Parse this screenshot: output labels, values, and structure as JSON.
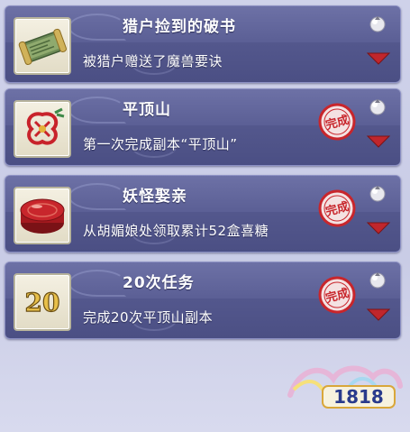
{
  "quests": [
    {
      "title": "猎户捡到的破书",
      "description": "被猎户赠送了魔兽要诀",
      "icon": "scroll-icon",
      "completed": false
    },
    {
      "title": "平顶山",
      "description": "第一次完成副本“平顶山”",
      "icon": "red-knot-icon",
      "completed": true
    },
    {
      "title": "妖怪娶亲",
      "description": "从胡媚娘处领取累计52盒喜糖",
      "icon": "candy-box-icon",
      "completed": true
    },
    {
      "title": "20次任务",
      "description": "完成20次平顶山副本",
      "icon": "number-20-icon",
      "completed": true
    }
  ],
  "icon_labels": {
    "number_20": "20"
  },
  "stamp": {
    "text": "完成",
    "color": "#c8262c"
  },
  "colors": {
    "card": "#53578d",
    "arrow": "#c0262c",
    "text": "#ffffff"
  },
  "watermark": {
    "text": "1818"
  }
}
